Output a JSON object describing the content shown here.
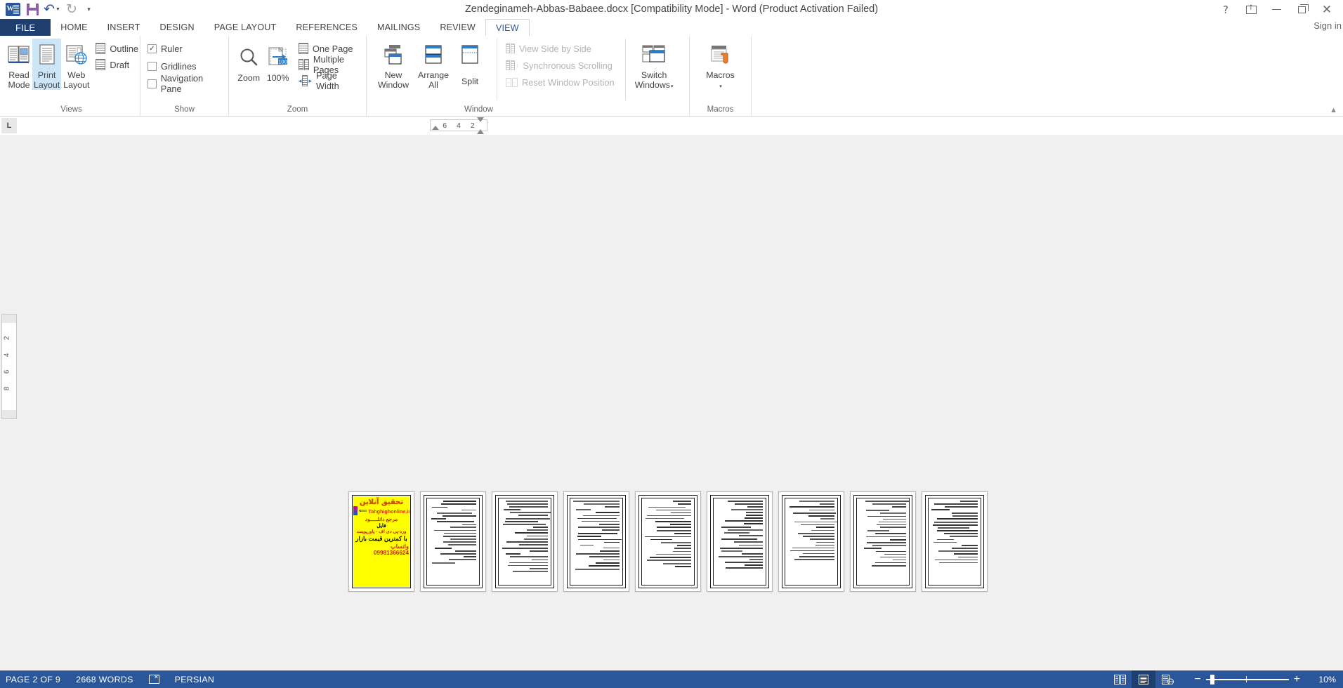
{
  "titlebar": {
    "document_title": "Zendeginameh-Abbas-Babaee.docx [Compatibility Mode] - Word (Product Activation Failed)",
    "quick_access": [
      {
        "name": "word-logo",
        "label": "W"
      },
      {
        "name": "save",
        "label": "Save"
      },
      {
        "name": "undo",
        "label": "Undo"
      },
      {
        "name": "redo",
        "label": "Repeat"
      },
      {
        "name": "customize-qat",
        "label": "Customize Quick Access Toolbar"
      }
    ],
    "window_controls": {
      "help": "?",
      "ribbon_display_options": "Ribbon Display Options",
      "minimize": "Minimize",
      "restore": "Restore Down",
      "close": "Close"
    },
    "sign_in": "Sign in"
  },
  "tabs": [
    {
      "label": "FILE",
      "active": false,
      "is_file": true
    },
    {
      "label": "HOME",
      "active": false
    },
    {
      "label": "INSERT",
      "active": false
    },
    {
      "label": "DESIGN",
      "active": false
    },
    {
      "label": "PAGE LAYOUT",
      "active": false
    },
    {
      "label": "REFERENCES",
      "active": false
    },
    {
      "label": "MAILINGS",
      "active": false
    },
    {
      "label": "REVIEW",
      "active": false
    },
    {
      "label": "VIEW",
      "active": true
    }
  ],
  "ribbon": {
    "groups": [
      {
        "name": "views",
        "label": "Views",
        "buttons": [
          {
            "label_line1": "Read",
            "label_line2": "Mode",
            "icon": "read-mode-icon",
            "selected": false
          },
          {
            "label_line1": "Print",
            "label_line2": "Layout",
            "icon": "print-layout-icon",
            "selected": true
          },
          {
            "label_line1": "Web",
            "label_line2": "Layout",
            "icon": "web-layout-icon",
            "selected": false
          }
        ],
        "small_items": [
          {
            "label": "Outline",
            "icon": "outline-icon"
          },
          {
            "label": "Draft",
            "icon": "draft-icon"
          }
        ]
      },
      {
        "name": "show",
        "label": "Show",
        "checkboxes": [
          {
            "label": "Ruler",
            "checked": true
          },
          {
            "label": "Gridlines",
            "checked": false
          },
          {
            "label": "Navigation Pane",
            "checked": false
          }
        ]
      },
      {
        "name": "zoom",
        "label": "Zoom",
        "buttons": [
          {
            "label_line1": "Zoom",
            "label_line2": "",
            "icon": "magnifier-icon"
          },
          {
            "label_line1": "100%",
            "label_line2": "",
            "icon": "zoom-100-icon"
          }
        ],
        "small_items": [
          {
            "label": "One Page",
            "icon": "one-page-icon"
          },
          {
            "label": "Multiple Pages",
            "icon": "multiple-pages-icon"
          },
          {
            "label": "Page Width",
            "icon": "page-width-icon"
          }
        ]
      },
      {
        "name": "window",
        "label": "Window",
        "buttons": [
          {
            "label_line1": "New",
            "label_line2": "Window",
            "icon": "new-window-icon"
          },
          {
            "label_line1": "Arrange",
            "label_line2": "All",
            "icon": "arrange-all-icon"
          },
          {
            "label_line1": "Split",
            "label_line2": "",
            "icon": "split-icon"
          }
        ],
        "small_items": [
          {
            "label": "View Side by Side",
            "icon": "view-side-by-side-icon",
            "disabled": true
          },
          {
            "label": "Synchronous Scrolling",
            "icon": "synchronous-scrolling-icon",
            "disabled": true
          },
          {
            "label": "Reset Window Position",
            "icon": "reset-window-position-icon",
            "disabled": true
          }
        ],
        "buttons2": [
          {
            "label_line1": "Switch",
            "label_line2": "Windows",
            "icon": "switch-windows-icon",
            "dropdown": true
          }
        ]
      },
      {
        "name": "macros",
        "label": "Macros",
        "buttons": [
          {
            "label_line1": "Macros",
            "label_line2": "",
            "icon": "macros-icon",
            "dropdown": true
          }
        ]
      }
    ]
  },
  "ruler": {
    "tab_stop_marker": "L",
    "horizontal_numbers": [
      "6",
      "4",
      "2"
    ],
    "vertical_numbers": [
      "2",
      "4",
      "6",
      "8"
    ]
  },
  "document": {
    "page_count": 9,
    "ad_page": {
      "heading": "تحقیق آنلاین",
      "website": "Tahghighonline.ir",
      "line3": "مرجع دانلـــــود",
      "line4": "فایل",
      "line5": "ورد-پی دی اف - پاورپوینت",
      "line6": "با کمترین قیمت بازار",
      "line7": "واتساپ 09981366624"
    },
    "text_pages": [
      {
        "index": 2,
        "line_count": 22
      },
      {
        "index": 3,
        "line_count": 25
      },
      {
        "index": 4,
        "line_count": 24
      },
      {
        "index": 5,
        "line_count": 23
      },
      {
        "index": 6,
        "line_count": 24
      },
      {
        "index": 7,
        "line_count": 21
      },
      {
        "index": 8,
        "line_count": 23
      },
      {
        "index": 9,
        "line_count": 22
      }
    ]
  },
  "statusbar": {
    "page_indicator": "PAGE 2 OF 9",
    "word_count": "2668 WORDS",
    "proofing_icon": "proofing-errors-icon",
    "language": "PERSIAN",
    "view_buttons": [
      {
        "name": "read-mode-view",
        "active": false
      },
      {
        "name": "print-layout-view",
        "active": true
      },
      {
        "name": "web-layout-view",
        "active": false
      }
    ],
    "zoom_out": "−",
    "zoom_in": "+",
    "zoom_level": "10%"
  },
  "colors": {
    "brand": "#2b579a",
    "file_tab": "#1e3f6f",
    "ribbon_bg": "#ffffff",
    "canvas_bg": "#f0f0f0",
    "ad_bg": "#ffff00",
    "ad_red": "#e03000",
    "selected_button": "#cde6f7"
  }
}
